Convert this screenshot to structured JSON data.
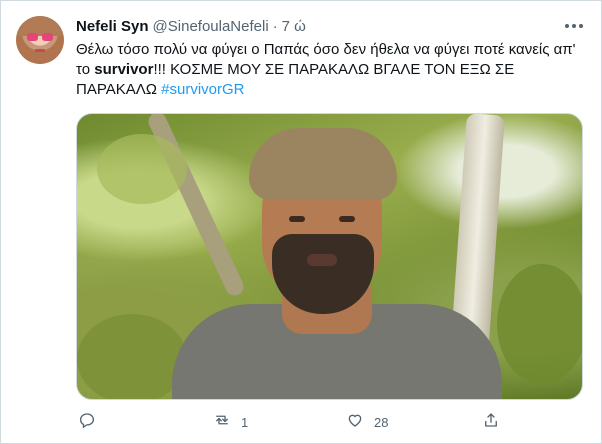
{
  "author": {
    "name": "Nefeli Syn",
    "handle": "@SinefoulaNefeli",
    "separator": "·",
    "time": "7 ώ"
  },
  "tweet": {
    "text_part1": "Θέλω τόσο πολύ να φύγει ο Παπάς όσο δεν ήθελα να φύγει ποτέ κανείς απ' το ",
    "bold": "survivor",
    "text_part2": "!!! ΚΟΣΜΕ ΜΟΥ ΣΕ ΠΑΡΑΚΑΛΩ ΒΓΑΛΕ ΤΟΝ ΕΞΩ ΣΕ ΠΑΡΑΚΑΛΩ ",
    "hashtag": "#survivorGR"
  },
  "actions": {
    "reply_count": "",
    "retweet_count": "1",
    "like_count": "28"
  },
  "icons": {
    "reply": "reply-icon",
    "retweet": "retweet-icon",
    "like": "like-icon",
    "share": "share-icon",
    "more": "more-icon"
  },
  "colors": {
    "hashtag": "#1d9bf0",
    "secondary_text": "#536471",
    "primary_text": "#0f1419"
  }
}
